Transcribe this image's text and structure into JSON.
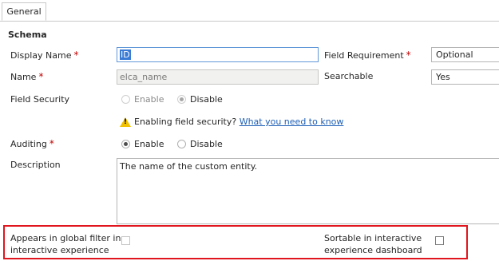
{
  "tabs": [
    {
      "label": "General"
    }
  ],
  "schema": {
    "title": "Schema",
    "display_name": {
      "label": "Display Name",
      "value": "ID"
    },
    "name": {
      "label": "Name",
      "value": "elca_name"
    },
    "field_requirement": {
      "label": "Field Requirement",
      "value": "Optional"
    },
    "searchable": {
      "label": "Searchable",
      "value": "Yes"
    },
    "field_security": {
      "label": "Field Security",
      "options": [
        "Enable",
        "Disable"
      ],
      "selected": "Disable",
      "warning_text": "Enabling field security?",
      "warning_link": "What you need to know"
    },
    "auditing": {
      "label": "Auditing",
      "options": [
        "Enable",
        "Disable"
      ],
      "selected": "Enable"
    },
    "description": {
      "label": "Description",
      "value": "The name of the custom entity."
    },
    "global_filter": {
      "label_line1": "Appears in global filter in",
      "label_line2": "interactive experience"
    },
    "sortable": {
      "label_line1": "Sortable in interactive",
      "label_line2": "experience dashboard"
    },
    "required_marker": "*"
  },
  "colors": {
    "highlight_border": "#e0151e",
    "link": "#1f5fb5",
    "required": "#c00000"
  }
}
